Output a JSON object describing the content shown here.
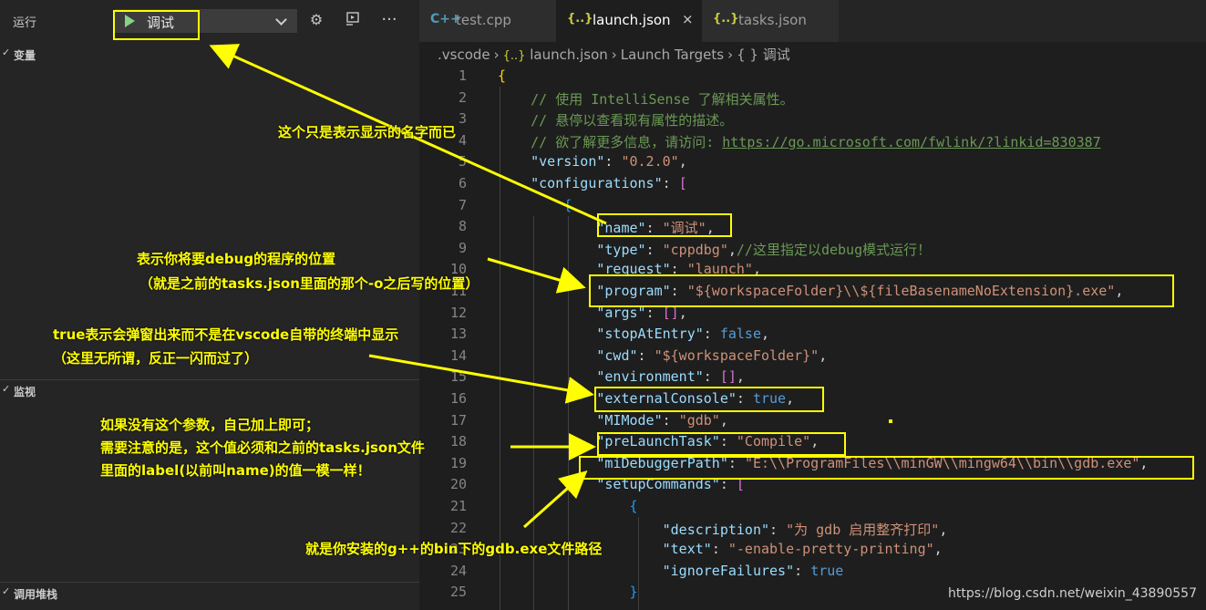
{
  "sidebar": {
    "run_label": "运行",
    "config_selected": "调试",
    "sections": {
      "variables": "变量",
      "watch": "监视",
      "callstack": "调用堆栈"
    }
  },
  "tabs": [
    {
      "icon": "C++",
      "label": "test.cpp"
    },
    {
      "icon": "{..}",
      "label": "launch.json",
      "close": "×"
    },
    {
      "icon": "{..}",
      "label": "tasks.json"
    }
  ],
  "breadcrumb": {
    "folder": ".vscode",
    "file_icon": "{..}",
    "file": "launch.json",
    "node1": "Launch Targets",
    "node2_icon": "{ }",
    "node2": "调试"
  },
  "code_lines": [
    {
      "n": "1"
    },
    {
      "n": "2"
    },
    {
      "n": "3"
    },
    {
      "n": "4"
    },
    {
      "n": "5"
    },
    {
      "n": "6"
    },
    {
      "n": "7"
    },
    {
      "n": "8"
    },
    {
      "n": "9"
    },
    {
      "n": "10"
    },
    {
      "n": "11"
    },
    {
      "n": "12"
    },
    {
      "n": "13"
    },
    {
      "n": "14"
    },
    {
      "n": "15"
    },
    {
      "n": "16"
    },
    {
      "n": "17"
    },
    {
      "n": "18"
    },
    {
      "n": "19"
    },
    {
      "n": "20"
    },
    {
      "n": "21"
    },
    {
      "n": "22"
    },
    {
      "n": "23"
    },
    {
      "n": "24"
    },
    {
      "n": "25"
    }
  ],
  "code": {
    "comment1": "// 使用 IntelliSense 了解相关属性。",
    "comment2": "// 悬停以查看现有属性的描述。",
    "comment3_prefix": "// 欲了解更多信息，请访问: ",
    "comment3_link": "https://go.microsoft.com/fwlink/?linkid=830387",
    "version_key": "\"version\"",
    "version_val": "\"0.2.0\"",
    "configurations_key": "\"configurations\"",
    "name_key": "\"name\"",
    "name_val": "\"调试\"",
    "type_key": "\"type\"",
    "type_val": "\"cppdbg\"",
    "type_comment": "//这里指定以debug模式运行！",
    "request_key": "\"request\"",
    "request_val": "\"launch\"",
    "program_key": "\"program\"",
    "program_val": "\"${workspaceFolder}\\\\${fileBasenameNoExtension}.exe\"",
    "args_key": "\"args\"",
    "stop_key": "\"stopAtEntry\"",
    "stop_val": "false",
    "cwd_key": "\"cwd\"",
    "cwd_val": "\"${workspaceFolder}\"",
    "env_key": "\"environment\"",
    "ext_key": "\"externalConsole\"",
    "ext_val": "true",
    "mimode_key": "\"MIMode\"",
    "mimode_val": "\"gdb\"",
    "prelaunch_key": "\"preLaunchTask\"",
    "prelaunch_val": "\"Compile\"",
    "midbg_key": "\"miDebuggerPath\"",
    "midbg_val": "\"E:\\\\ProgramFiles\\\\minGW\\\\mingw64\\\\bin\\\\gdb.exe\"",
    "setup_key": "\"setupCommands\"",
    "desc_key": "\"description\"",
    "desc_val": "\"为 gdb 启用整齐打印\"",
    "text_key": "\"text\"",
    "text_val": "\"-enable-pretty-printing\"",
    "ignore_key": "\"ignoreFailures\"",
    "ignore_val": "true"
  },
  "annotations": {
    "a1": "这个只是表示显示的名字而已",
    "a2_line1": "表示你将要debug的程序的位置",
    "a2_line2": "（就是之前的tasks.json里面的那个-o之后写的位置）",
    "a3_line1": "true表示会弹窗出来而不是在vscode自带的终端中显示",
    "a3_line2": "（这里无所谓，反正一闪而过了）",
    "a4_line1": "如果没有这个参数，自己加上即可；",
    "a4_line2": "需要注意的是，这个值必须和之前的tasks.json文件",
    "a4_line3": "里面的label(以前叫name)的值一模一样！",
    "a5": "就是你安装的g++的bin下的gdb.exe文件路径"
  },
  "watermark": "https://blog.csdn.net/weixin_43890557",
  "colors": {
    "annotation": "#ffff00",
    "sidebar_bg": "#252526",
    "editor_bg": "#1e1e1e",
    "comment": "#6a9955",
    "key": "#9cdcfe",
    "string": "#ce9178",
    "keyword": "#569cd6"
  }
}
